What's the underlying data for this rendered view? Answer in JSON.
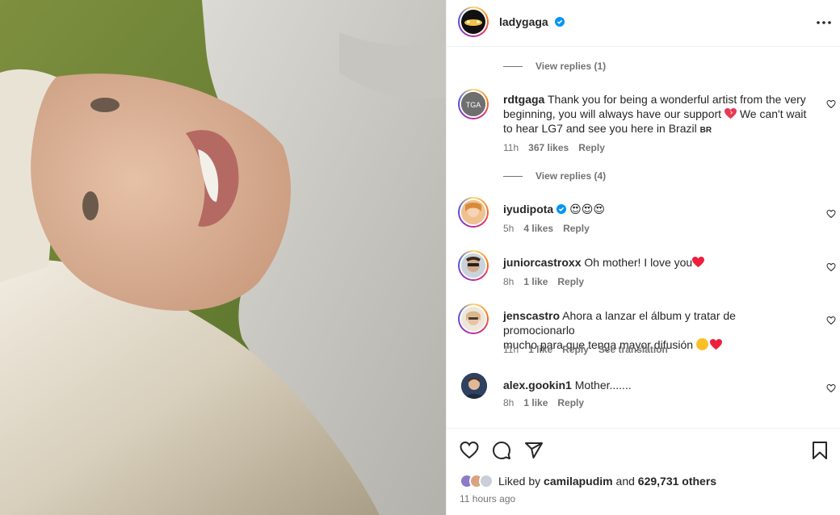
{
  "post": {
    "author": "ladygaga",
    "verified": true
  },
  "comments_section": {
    "top_replies": "View replies (1)",
    "comments": [
      {
        "user": "rdtgaga",
        "text": "Thank you for being a wonderful artist from the very beginning, you will always have our support 💝 We can't wait to hear LG7 and see you here in Brazil 🇧🇷",
        "text_line1": "Thank you for being a wonderful artist from the very",
        "text_line2": "beginning, you will always have our support",
        "text_line2b": "We can't wait",
        "text_line3": "to hear LG7 and see you here in Brazil",
        "flag": "BR",
        "time": "11h",
        "likes": "367 likes",
        "reply": "Reply",
        "replies": "View replies (4)"
      },
      {
        "user": "iyudipota",
        "verified": true,
        "text": "😍😍😍",
        "time": "5h",
        "likes": "4 likes",
        "reply": "Reply"
      },
      {
        "user": "juniorcastroxx",
        "text": "Oh mother! I love you",
        "time": "8h",
        "likes": "1 like",
        "reply": "Reply"
      },
      {
        "user": "jenscastro",
        "text_line1": "Ahora a lanzar el álbum y tratar de promocionarlo",
        "text_line2": "mucho para que tenga mayor difusión",
        "time": "11h",
        "likes": "1 like",
        "reply": "Reply",
        "translation": "See translation"
      },
      {
        "user": "alex.gookin1",
        "text": "Mother.......",
        "time": "8h",
        "likes": "1 like",
        "reply": "Reply"
      }
    ]
  },
  "footer": {
    "liked_by_prefix": "Liked by",
    "liked_by_user": "camilapudim",
    "and": "and",
    "others": "629,731 others",
    "time_ago": "11 hours ago"
  },
  "icons": [
    "heart-icon",
    "comment-icon",
    "share-icon",
    "bookmark-icon",
    "more-icon",
    "verified-icon"
  ],
  "colors": {
    "verified": "#0095f6",
    "heart_red": "#ed1f3b",
    "muted": "#737373"
  }
}
